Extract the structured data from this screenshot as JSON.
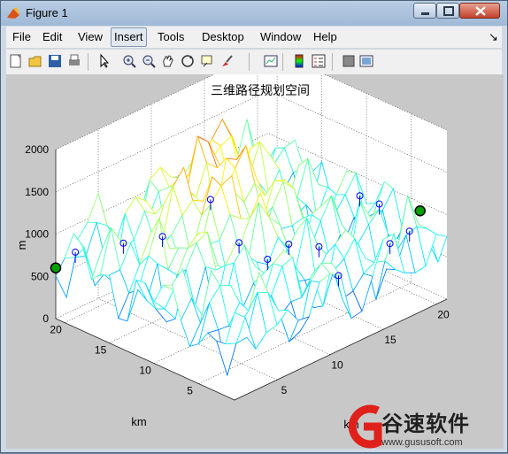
{
  "window": {
    "title": "Figure 1"
  },
  "menu": [
    {
      "label": "File",
      "active": false
    },
    {
      "label": "Edit",
      "active": false
    },
    {
      "label": "View",
      "active": false
    },
    {
      "label": "Insert",
      "active": true
    },
    {
      "label": "Tools",
      "active": false
    },
    {
      "label": "Desktop",
      "active": false
    },
    {
      "label": "Window",
      "active": false
    },
    {
      "label": "Help",
      "active": false
    }
  ],
  "toolbar": [
    "new-figure-icon",
    "open-icon",
    "save-icon",
    "print-icon",
    "pointer-icon",
    "zoom-in-icon",
    "zoom-out-icon",
    "pan-icon",
    "rotate-icon",
    "data-cursor-icon",
    "brush-icon",
    "link-icon",
    "colorbar-icon",
    "legend-icon",
    "hide-plot-tools-icon",
    "show-plot-tools-icon"
  ],
  "chart_data": {
    "type": "surface3d",
    "title": "三维路径规划空间",
    "xlabel": "km",
    "ylabel": "km",
    "zlabel": "m",
    "x_ticks": [
      "5",
      "10",
      "15",
      "20"
    ],
    "y_ticks": [
      "5",
      "10",
      "15",
      "20"
    ],
    "z_ticks": [
      "0",
      "500",
      "1000",
      "1500",
      "2000"
    ],
    "xlim": [
      1,
      21
    ],
    "ylim": [
      1,
      21
    ],
    "zlim": [
      0,
      2000
    ],
    "grid": true,
    "start_point": {
      "x": 1,
      "y": 21,
      "z": 600
    },
    "end_point": {
      "x": 21,
      "y": 4,
      "z": 900
    }
  },
  "watermark": {
    "brand": "谷速软件",
    "url": "www.gususoft.com"
  },
  "colors": {
    "window_bg": "#cfd9e6",
    "figure_bg": "#c8c8c8",
    "axes_bg": "#ffffff",
    "start_marker": "#00a000"
  }
}
